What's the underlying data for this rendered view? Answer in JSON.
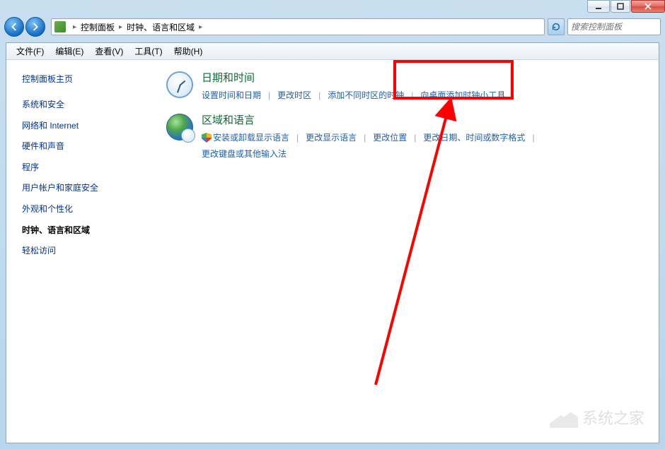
{
  "titlebar": {
    "minimize_tip": "最小化",
    "maximize_tip": "最大化",
    "close_tip": "关闭"
  },
  "breadcrumb": {
    "seg1": "控制面板",
    "seg2": "时钟、语言和区域"
  },
  "search": {
    "placeholder": "搜索控制面板"
  },
  "menubar": {
    "file": "文件(F)",
    "edit": "编辑(E)",
    "view": "查看(V)",
    "tools": "工具(T)",
    "help": "帮助(H)"
  },
  "sidebar": {
    "home": "控制面板主页",
    "items": [
      "系统和安全",
      "网络和 Internet",
      "硬件和声音",
      "程序",
      "用户帐户和家庭安全",
      "外观和个性化",
      "时钟、语言和区域",
      "轻松访问"
    ],
    "active_index": 6
  },
  "main": {
    "categories": [
      {
        "title": "日期和时间",
        "links": [
          {
            "label": "设置时间和日期",
            "shield": false
          },
          {
            "label": "更改时区",
            "shield": false
          },
          {
            "label": "添加不同时区的时钟",
            "shield": false
          },
          {
            "label": "向桌面添加时钟小工具",
            "shield": false
          }
        ]
      },
      {
        "title": "区域和语言",
        "links": [
          {
            "label": "安装或卸载显示语言",
            "shield": true
          },
          {
            "label": "更改显示语言",
            "shield": false
          },
          {
            "label": "更改位置",
            "shield": false
          },
          {
            "label": "更改日期、时间或数字格式",
            "shield": false
          }
        ],
        "row2": [
          {
            "label": "更改键盘或其他输入法",
            "shield": false
          }
        ]
      }
    ]
  },
  "watermark": {
    "text": "系统之家"
  }
}
